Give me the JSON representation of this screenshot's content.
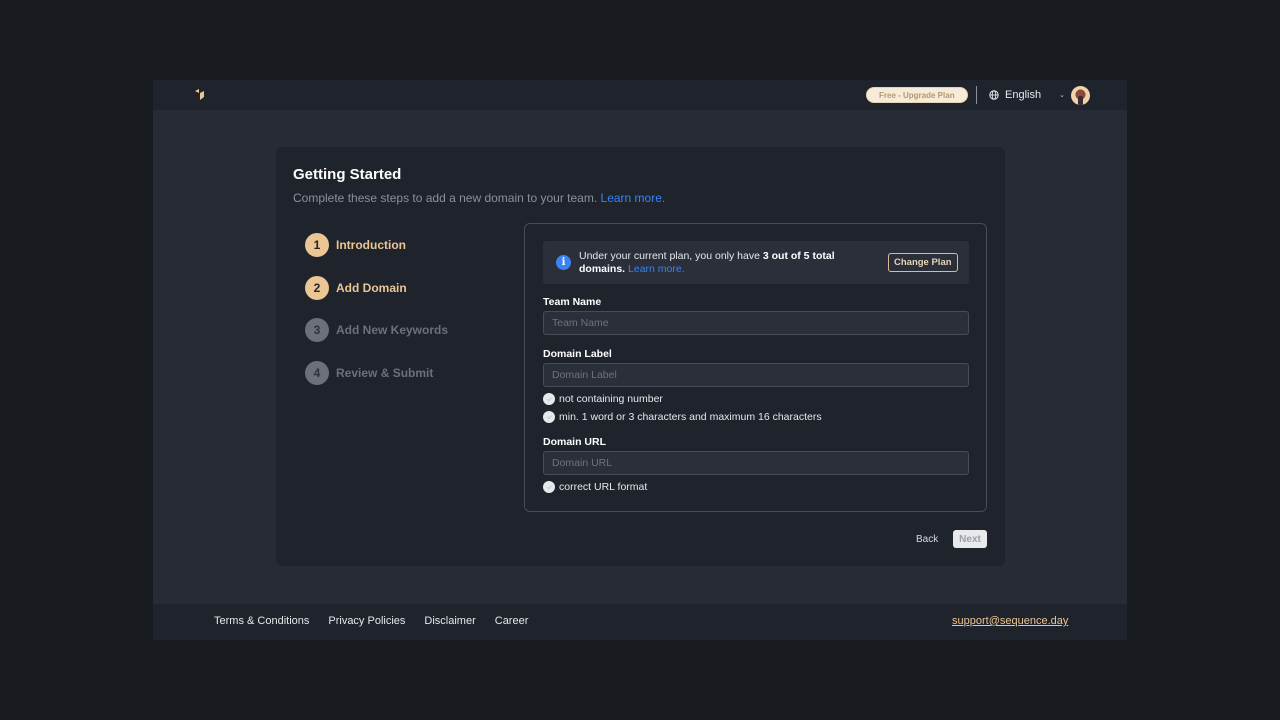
{
  "topbar": {
    "logo": "sequence-logo-icon",
    "plan_badge": "Free - Upgrade Plan",
    "language": "English",
    "avatar": "user-avatar"
  },
  "card": {
    "title": "Getting Started",
    "subtitle": "Complete these steps to add a new domain to your team.",
    "learn_more": "Learn more."
  },
  "steps": [
    {
      "number": "1",
      "label": "Introduction",
      "state": "done"
    },
    {
      "number": "2",
      "label": "Add Domain",
      "state": "active"
    },
    {
      "number": "3",
      "label": "Add New Keywords",
      "state": "todo"
    },
    {
      "number": "4",
      "label": "Review & Submit",
      "state": "todo"
    }
  ],
  "notice": {
    "icon": "i",
    "text_before": "Under your current plan, you only have ",
    "text_bold": "3 out of 5 total domains.",
    "learn_more": "Learn more.",
    "button": "Change Plan"
  },
  "form": {
    "team_name": {
      "label": "Team Name",
      "placeholder": "Team Name",
      "value": ""
    },
    "domain_label": {
      "label": "Domain Label",
      "placeholder": "Domain Label",
      "value": "",
      "rules": [
        "not containing number",
        "min. 1 word or 3 characters and maximum 16 characters"
      ]
    },
    "domain_url": {
      "label": "Domain URL",
      "placeholder": "Domain URL",
      "value": "",
      "rules": [
        "correct URL format"
      ]
    }
  },
  "actions": {
    "back": "Back",
    "next": "Next"
  },
  "footer": {
    "links": [
      "Terms & Conditions",
      "Privacy Policies",
      "Disclaimer",
      "Career"
    ],
    "support_email": "support@sequence.day"
  },
  "colors": {
    "accent": "#ecc595",
    "link": "#3b82f6",
    "background": "#262b35",
    "card": "#1f232b"
  }
}
